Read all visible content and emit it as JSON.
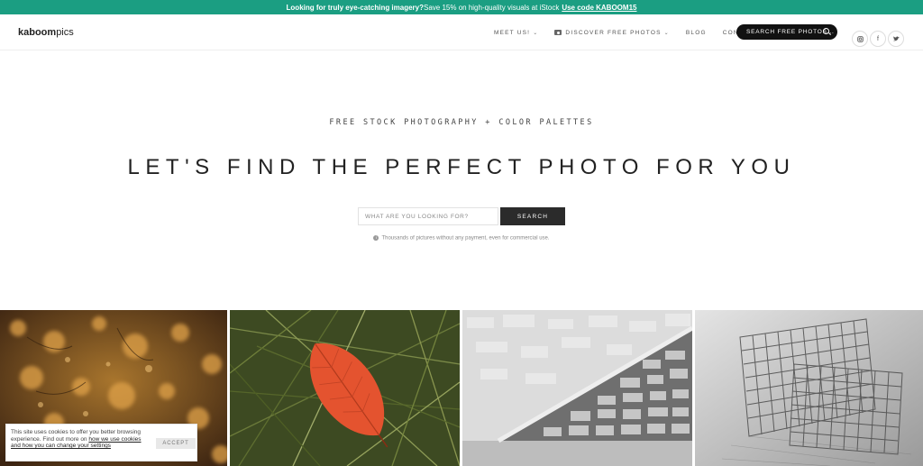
{
  "promo": {
    "lead": "Looking for truly eye-catching imagery?",
    "text": " Save 15% on high-quality visuals at iStock ",
    "code_link": "Use code KABOOM15",
    "bg_color": "#1b9e82"
  },
  "logo": {
    "bold": "kaboom",
    "light": "pics"
  },
  "nav": {
    "items": [
      {
        "label": "MEET US!",
        "caret": "⌄"
      },
      {
        "label": "DISCOVER FREE PHOTOS",
        "caret": "⌄",
        "icon": "camera-icon"
      },
      {
        "label": "BLOG"
      },
      {
        "label": "CONTACT"
      }
    ],
    "search_label": "SEARCH FREE PHOTOS...",
    "social": [
      {
        "icon": "instagram-icon",
        "glyph": "◙"
      },
      {
        "icon": "facebook-icon",
        "glyph": "f"
      },
      {
        "icon": "twitter-icon",
        "glyph": "t"
      }
    ]
  },
  "hero": {
    "tagline": "FREE STOCK PHOTOGRAPHY + COLOR PALETTES",
    "headline": "LET'S FIND THE PERFECT PHOTO FOR YOU",
    "search_placeholder": "WHAT ARE YOU LOOKING FOR?",
    "search_button": "SEARCH",
    "note": "Thousands of pictures without any payment, even for commercial use."
  },
  "gallery": [
    {
      "subject": "autumn-bokeh"
    },
    {
      "subject": "red-leaf-grass"
    },
    {
      "subject": "stone-wall-stairs"
    },
    {
      "subject": "wire-grid"
    }
  ],
  "cookie": {
    "text_before": "This site uses cookies to offer you better browsing experience. Find out more on ",
    "link": "how we use cookies and how you can change your settings",
    "accept": "ACCEPT"
  }
}
